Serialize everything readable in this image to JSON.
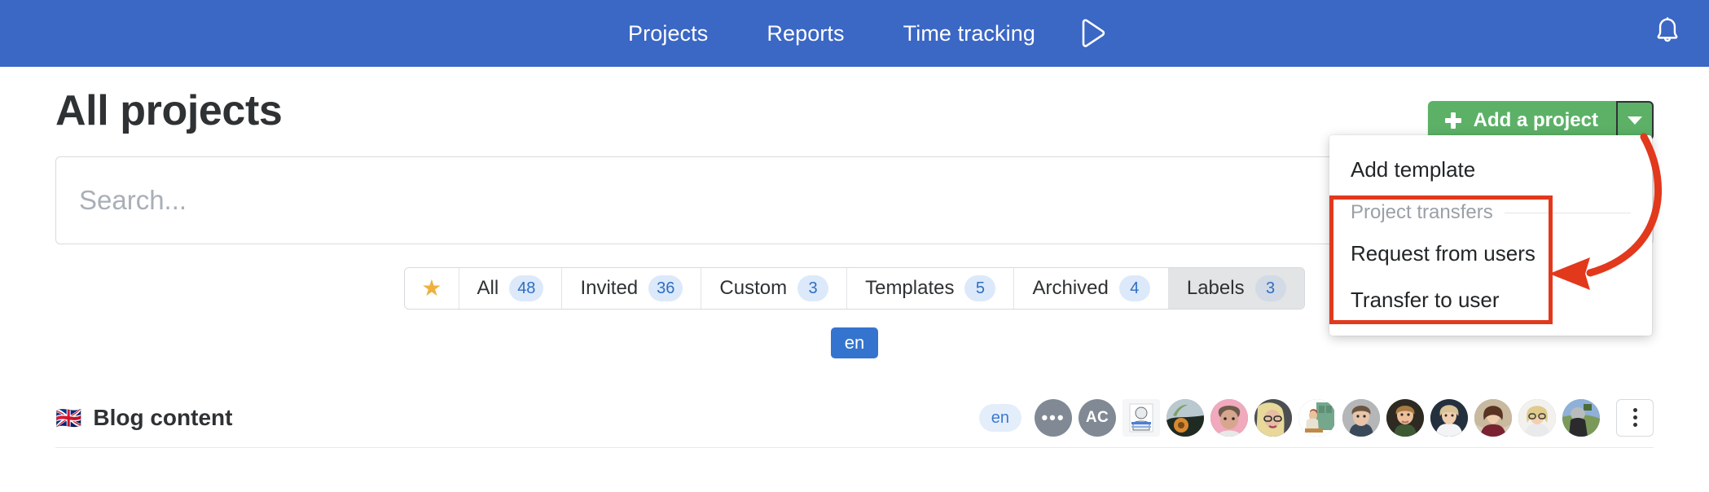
{
  "navbar": {
    "links": [
      {
        "label": "Projects"
      },
      {
        "label": "Reports"
      },
      {
        "label": "Time tracking"
      }
    ],
    "play_icon": "play-icon",
    "bell_icon": "bell-icon",
    "background_color": "#3b67c5"
  },
  "header": {
    "title": "All projects",
    "add_project": {
      "label": "Add a project",
      "plus_icon": "plus-icon",
      "caret_icon": "chevron-down-icon",
      "color": "#5cb167"
    }
  },
  "search": {
    "value": "",
    "placeholder": "Search..."
  },
  "tabs": {
    "star_icon": "star-icon",
    "items": [
      {
        "label": "All",
        "count": "48",
        "active": false
      },
      {
        "label": "Invited",
        "count": "36",
        "active": false
      },
      {
        "label": "Custom",
        "count": "3",
        "active": false
      },
      {
        "label": "Templates",
        "count": "5",
        "active": false
      },
      {
        "label": "Archived",
        "count": "4",
        "active": false
      },
      {
        "label": "Labels",
        "count": "3",
        "active": true
      }
    ]
  },
  "language_filter": {
    "selected": "en"
  },
  "projects": [
    {
      "flag": "🇬🇧",
      "name": "Blog content",
      "language_badge": "en",
      "members": [
        {
          "type": "initials",
          "label": "•••",
          "color": "#808994"
        },
        {
          "type": "initials",
          "label": "AC",
          "color": "#808994"
        },
        {
          "type": "photo",
          "label": "",
          "color": "#dfe3e6",
          "shape": "square"
        },
        {
          "type": "photo",
          "label": "",
          "color": "#6f8f73"
        },
        {
          "type": "photo",
          "label": "",
          "color": "#c2817a"
        },
        {
          "type": "photo",
          "label": "",
          "color": "#cdb9a6"
        },
        {
          "type": "photo",
          "label": "",
          "color": "#9aa87d"
        },
        {
          "type": "photo",
          "label": "",
          "color": "#a9aaa8"
        },
        {
          "type": "photo",
          "label": "",
          "color": "#7a6144"
        },
        {
          "type": "photo",
          "label": "",
          "color": "#5d6b7a"
        },
        {
          "type": "photo",
          "label": "",
          "color": "#a0816f"
        },
        {
          "type": "photo",
          "label": "",
          "color": "#cfbfae"
        },
        {
          "type": "photo",
          "label": "",
          "color": "#7c9161"
        }
      ],
      "more_menu_icon": "kebab-menu-icon"
    }
  ],
  "dropdown": {
    "items": [
      {
        "label": "Add template",
        "type": "item"
      },
      {
        "label": "Project transfers",
        "type": "group"
      },
      {
        "label": "Request from users",
        "type": "item"
      },
      {
        "label": "Transfer to user",
        "type": "item"
      }
    ]
  },
  "annotations": {
    "highlight_color": "#e2381c",
    "shapes": [
      "rectangle",
      "curved-arrow"
    ]
  }
}
